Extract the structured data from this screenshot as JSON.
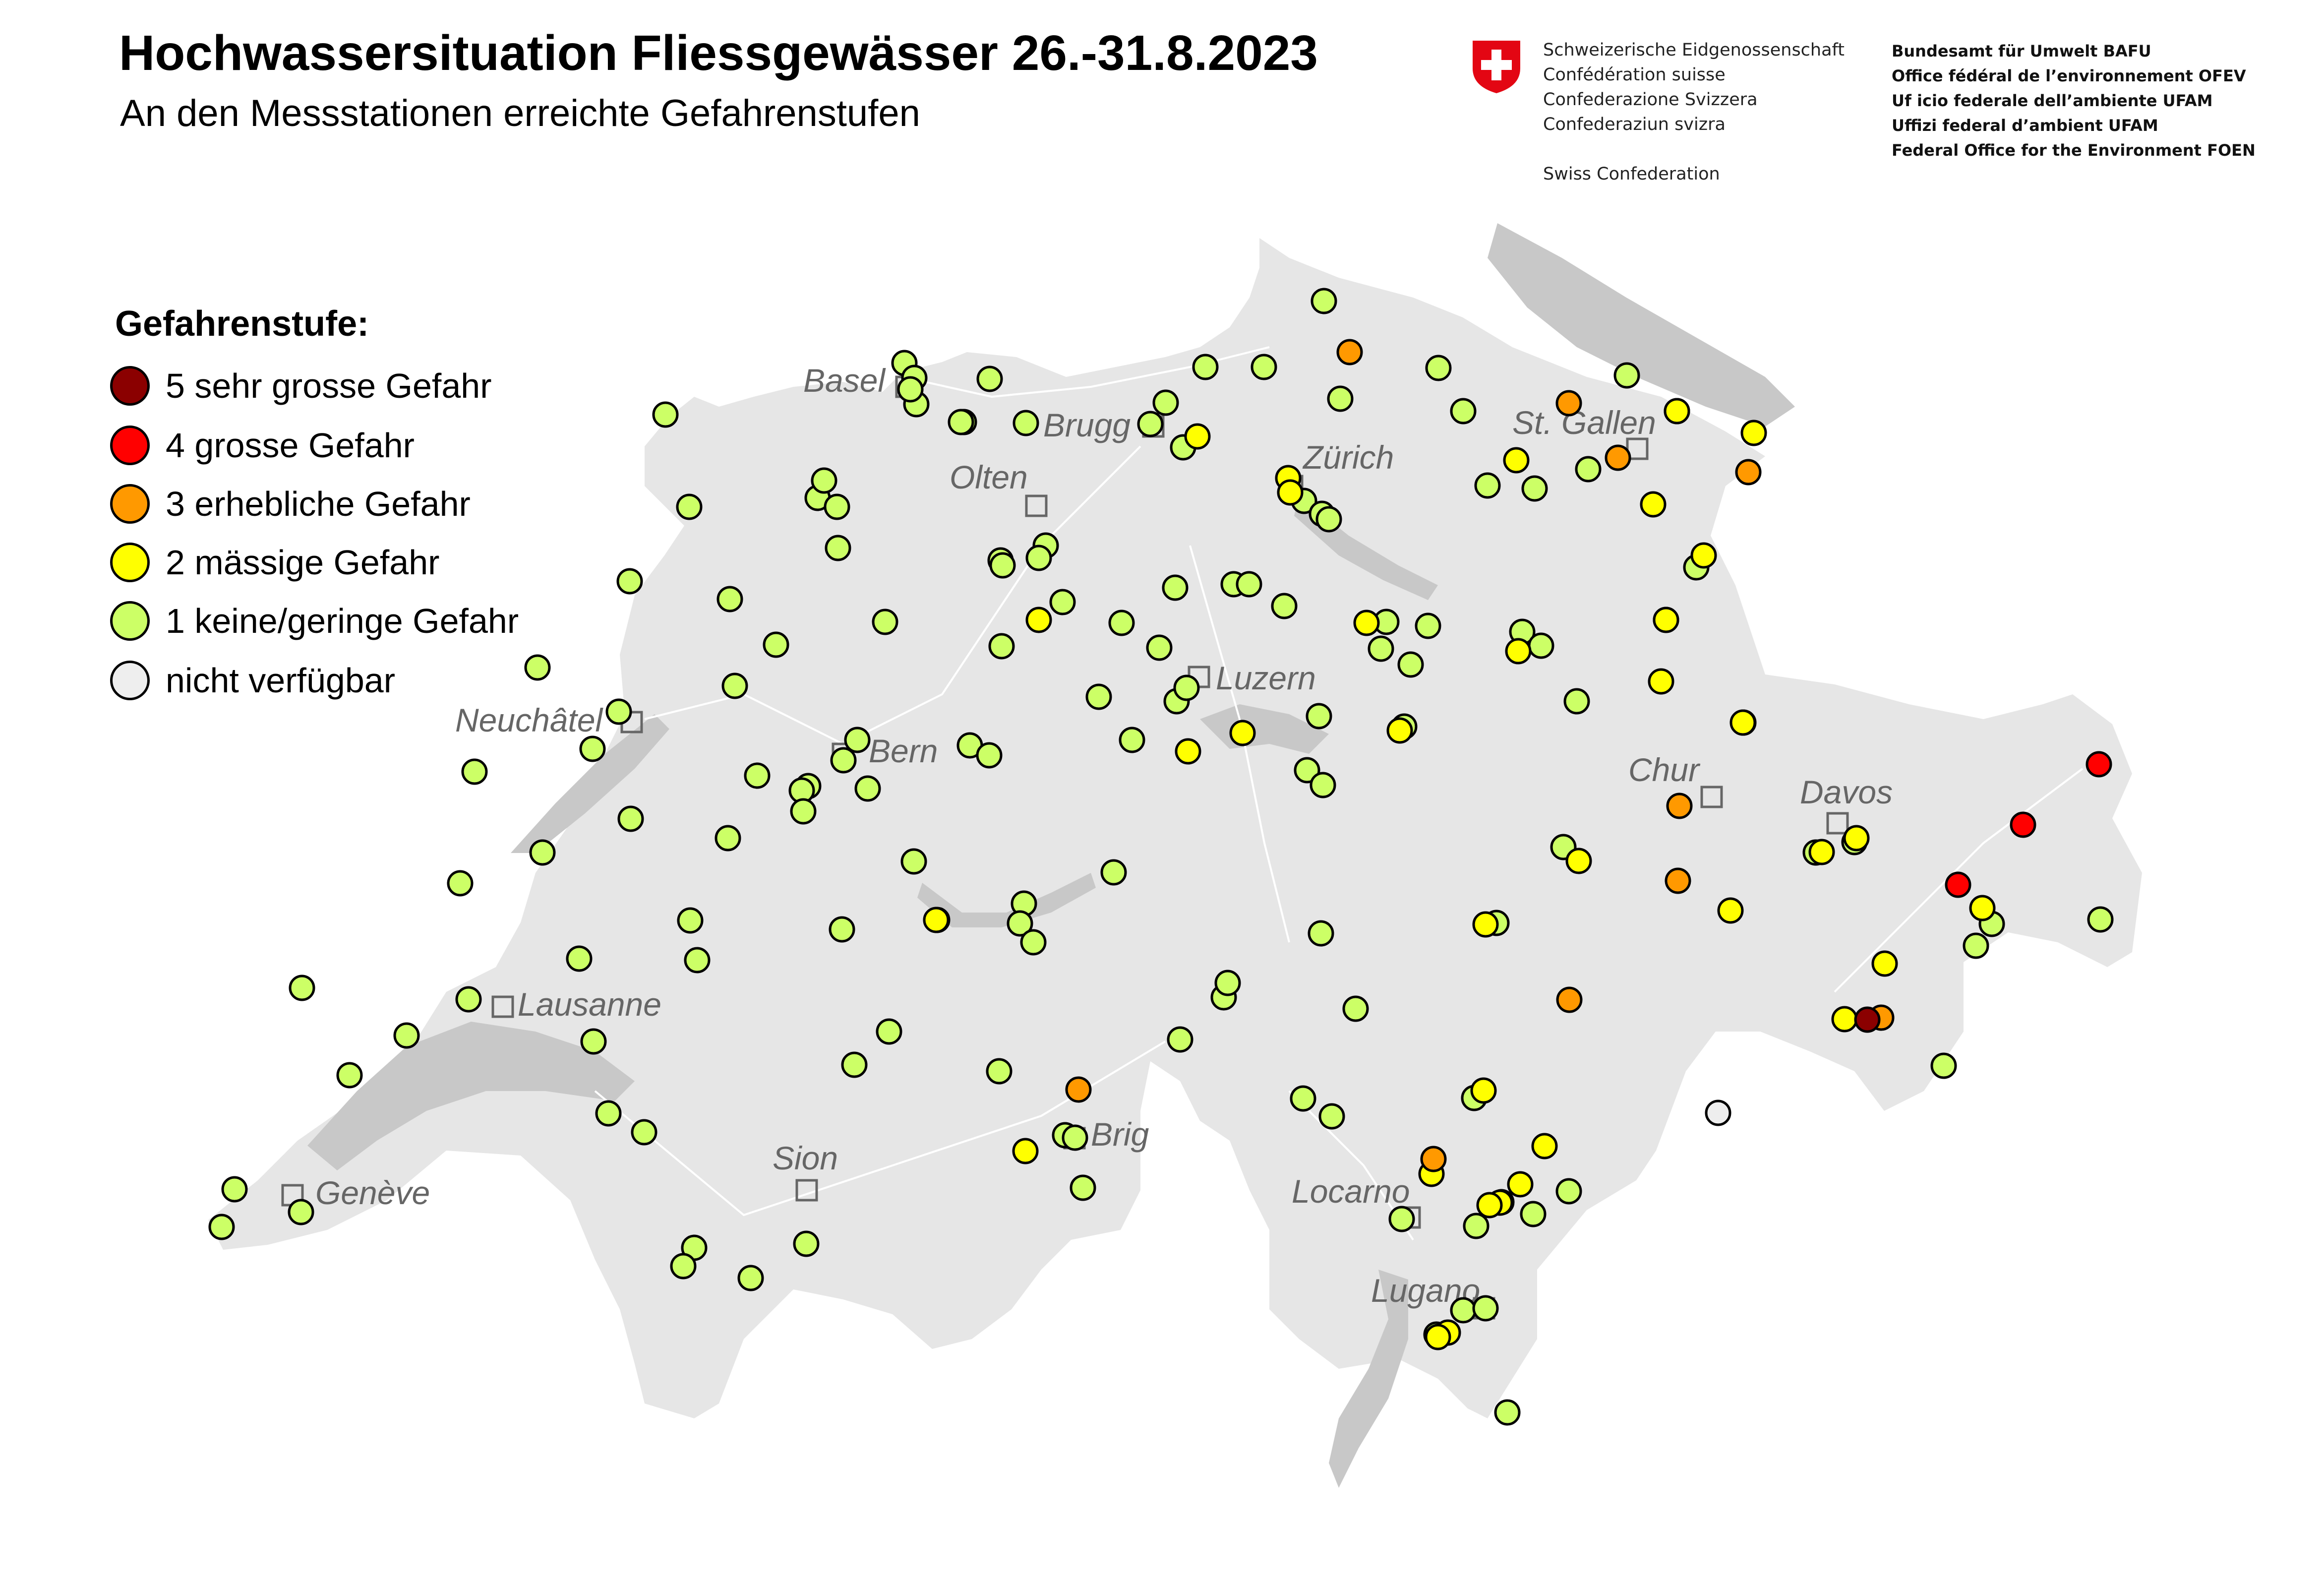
{
  "header": {
    "title": "Hochwassersituation Fliessgewässer 26.-31.8.2023",
    "subtitle": "An den Messstationen erreichte Gefahrenstufen"
  },
  "confederation": {
    "lines": [
      "Schweizerische Eidgenossenschaft",
      "Confédération suisse",
      "Confederazione Svizzera",
      "Confederaziun svizra"
    ],
    "english": "Swiss Confederation"
  },
  "office": {
    "lines": [
      "Bundesamt für Umwelt BAFU",
      "Office fédéral de l’environnement OFEV",
      "Uf icio federale dell’ambiente UFAM",
      "Uffizi federal d’ambient UFAM",
      "Federal Office for the Environment FOEN"
    ]
  },
  "legend": {
    "title": "Gefahrenstufe:",
    "items": [
      {
        "label": "5 sehr grosse Gefahr",
        "color": "#8b0000"
      },
      {
        "label": "4 grosse Gefahr",
        "color": "#ff0000"
      },
      {
        "label": "3 erhebliche Gefahr",
        "color": "#ff9900"
      },
      {
        "label": "2 mässige Gefahr",
        "color": "#ffff00"
      },
      {
        "label": "1 keine/geringe Gefahr",
        "color": "#ccff66"
      },
      {
        "label": "nicht verfügbar",
        "color": "#eeeeee"
      }
    ]
  },
  "cities": [
    "Basel",
    "Brugg",
    "Olten",
    "Zürich",
    "St. Gallen",
    "Luzern",
    "Neuchâtel",
    "Bern",
    "Chur",
    "Davos",
    "Lausanne",
    "Genève",
    "Sion",
    "Brig",
    "Locarno",
    "Lugano"
  ],
  "colors": {
    "land": "#e6e6e6",
    "lake": "#c8c8c8",
    "river": "#ffffff",
    "station_outline": "#000000"
  },
  "station_counts_by_level": {
    "5": 1,
    "4": 3,
    "3": 9,
    "2": 38,
    "1": 160,
    "na": 1
  }
}
